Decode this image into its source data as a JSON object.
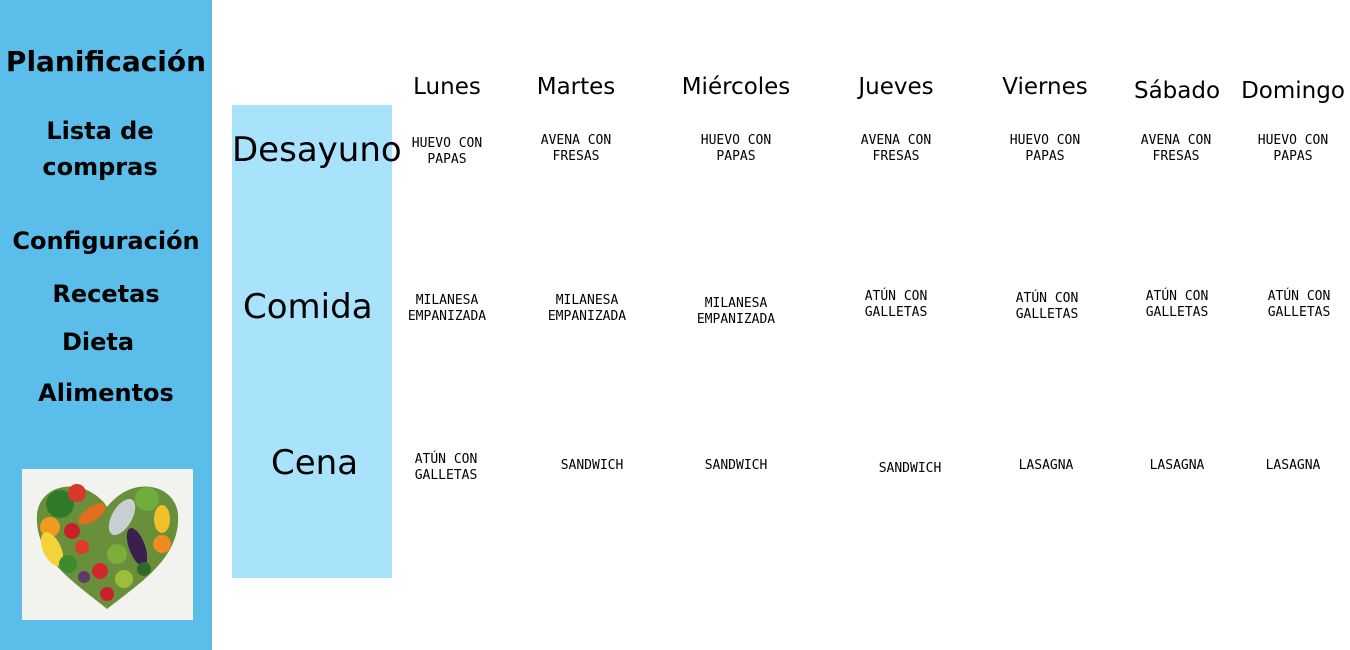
{
  "sidebar": {
    "title": "Planificación",
    "lista_line1": "Lista de",
    "lista_line2": "compras",
    "configuracion": "Configuración",
    "recetas": "Recetas",
    "dieta": "Dieta",
    "alimentos": "Alimentos",
    "color": "#5bbdea"
  },
  "meals": {
    "desayuno": "Desayuno",
    "comida": "Comida",
    "cena": "Cena",
    "column_color": "#a8e3fb"
  },
  "days": [
    "Lunes",
    "Martes",
    "Miércoles",
    "Jueves",
    "Viernes",
    "Sábado",
    "Domingo"
  ],
  "plan": {
    "desayuno": [
      [
        "HUEVO CON",
        "PAPAS"
      ],
      [
        "AVENA CON",
        "FRESAS"
      ],
      [
        "HUEVO CON",
        "PAPAS"
      ],
      [
        "AVENA CON",
        "FRESAS"
      ],
      [
        "HUEVO CON",
        "PAPAS"
      ],
      [
        "AVENA CON",
        "FRESAS"
      ],
      [
        "HUEVO CON",
        "PAPAS"
      ]
    ],
    "comida": [
      [
        "MILANESA",
        "EMPANIZADA"
      ],
      [
        "MILANESA",
        "EMPANIZADA"
      ],
      [
        "MILANESA",
        "EMPANIZADA"
      ],
      [
        "ATÚN CON",
        "GALLETAS"
      ],
      [
        "ATÚN CON",
        "GALLETAS"
      ],
      [
        "ATÚN CON",
        "GALLETAS"
      ],
      [
        "ATÚN CON",
        "GALLETAS"
      ]
    ],
    "cena": [
      [
        "ATÚN CON",
        "GALLETAS"
      ],
      [
        "SANDWICH"
      ],
      [
        "SANDWICH"
      ],
      [
        "SANDWICH"
      ],
      [
        "LASAGNA"
      ],
      [
        "LASAGNA"
      ],
      [
        "LASAGNA"
      ]
    ]
  },
  "image": {
    "icon": "vegetable-heart-image"
  }
}
